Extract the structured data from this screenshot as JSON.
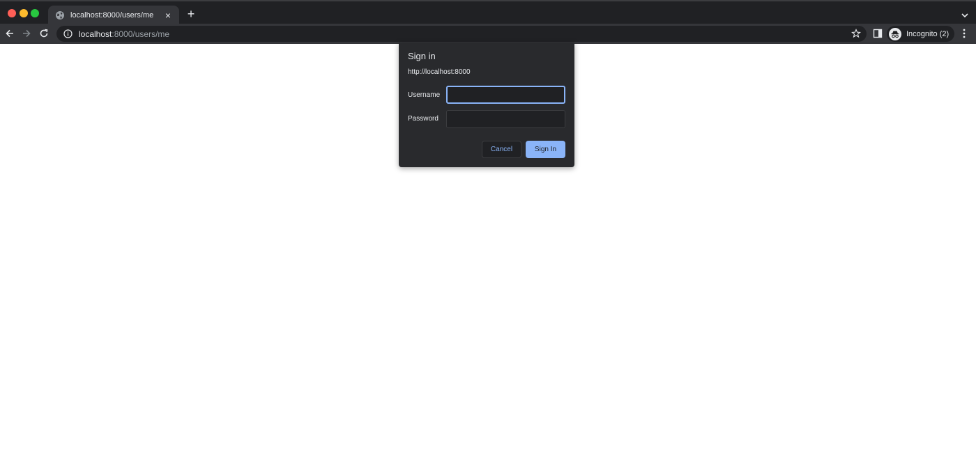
{
  "tab": {
    "title": "localhost:8000/users/me",
    "close_glyph": "×",
    "new_tab_glyph": "+"
  },
  "omnibox": {
    "host": "localhost",
    "path": ":8000/users/me"
  },
  "profile": {
    "label": "Incognito (2)"
  },
  "dialog": {
    "title": "Sign in",
    "origin": "http://localhost:8000",
    "username_label": "Username",
    "password_label": "Password",
    "username_value": "",
    "password_value": "",
    "cancel_label": "Cancel",
    "signin_label": "Sign In"
  },
  "colors": {
    "accent": "#8ab4f8",
    "chrome_dark": "#202124",
    "toolbar": "#35363a",
    "dialog_bg": "#292a2d"
  },
  "icons": [
    "globe-icon",
    "close-icon",
    "plus-icon",
    "chevron-down-icon",
    "back-arrow-icon",
    "forward-arrow-icon",
    "reload-icon",
    "info-icon",
    "star-icon",
    "side-panel-icon",
    "incognito-icon",
    "kebab-menu-icon"
  ]
}
